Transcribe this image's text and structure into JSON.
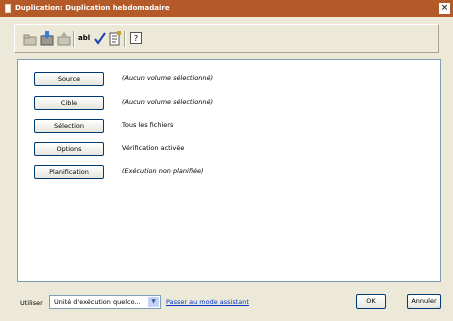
{
  "window": {
    "title": "Duplication: Duplication hebdomadaire",
    "close_glyph": "×"
  },
  "toolbar": {
    "icons": [
      "open-folder-icon",
      "save-icon",
      "folder-up-icon",
      "rename-abl-icon",
      "check-icon",
      "properties-icon",
      "help-icon"
    ],
    "rename_text": "abl"
  },
  "settings": [
    {
      "button": "Source",
      "value": "(Aucun volume sélectionné)",
      "italic": true
    },
    {
      "button": "Cible",
      "value": "(Aucun volume sélectionné)",
      "italic": true
    },
    {
      "button": "Sélection",
      "value": "Tous les fichiers",
      "italic": false
    },
    {
      "button": "Options",
      "value": "Vérification activée",
      "italic": false
    },
    {
      "button": "Planification",
      "value": "(Exécution non planifiée)",
      "italic": true
    }
  ],
  "footer": {
    "use_label": "Utiliser",
    "select_value": "Unité d'exécution quelco...",
    "wizard_link": "Passer au mode assistant",
    "ok": "OK",
    "cancel": "Annuler"
  }
}
